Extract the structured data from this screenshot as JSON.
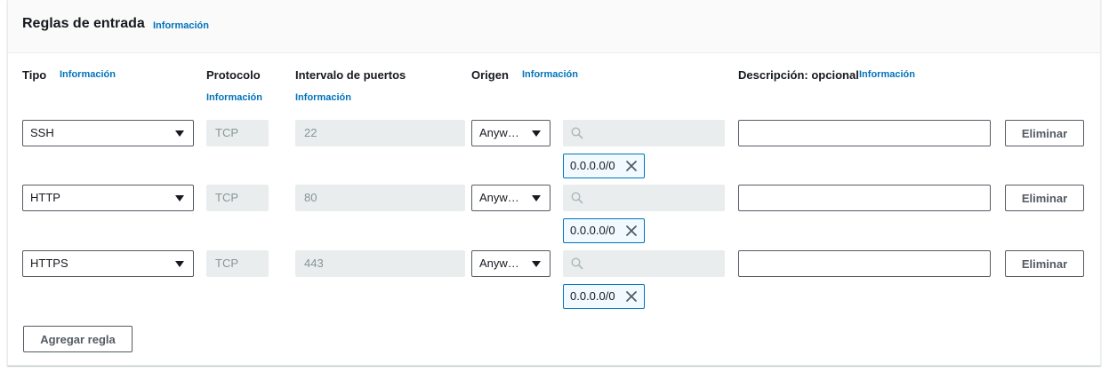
{
  "panel": {
    "title": "Reglas de entrada",
    "info_label": "Información"
  },
  "columns": {
    "type": "Tipo",
    "protocol": "Protocolo",
    "port_range": "Intervalo de puertos",
    "source": "Origen",
    "description": "Descripción: opcional",
    "info_label": "Información"
  },
  "rules": [
    {
      "type": "SSH",
      "protocol": "TCP",
      "port": "22",
      "source": "Anyw…",
      "search_placeholder": "",
      "cidr": "0.0.0.0/0",
      "description": "",
      "delete_label": "Eliminar"
    },
    {
      "type": "HTTP",
      "protocol": "TCP",
      "port": "80",
      "source": "Anyw…",
      "search_placeholder": "",
      "cidr": "0.0.0.0/0",
      "description": "",
      "delete_label": "Eliminar"
    },
    {
      "type": "HTTPS",
      "protocol": "TCP",
      "port": "443",
      "source": "Anyw…",
      "search_placeholder": "",
      "cidr": "0.0.0.0/0",
      "description": "",
      "delete_label": "Eliminar"
    }
  ],
  "add_rule_label": "Agregar regla",
  "icons": {
    "search": "search-icon",
    "close": "close-icon",
    "caret": "caret-down-icon"
  },
  "colors": {
    "link": "#0073bb",
    "token_border": "#0073bb",
    "token_bg": "#f1faff",
    "disabled_bg": "#eaeded"
  }
}
